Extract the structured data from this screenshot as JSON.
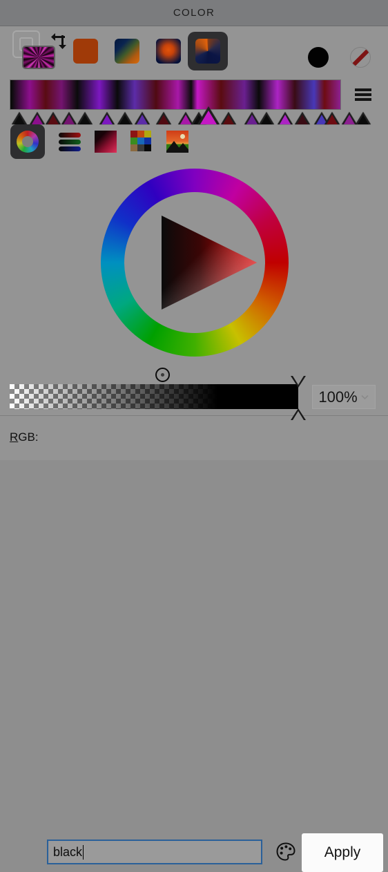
{
  "window": {
    "title": "COLOR"
  },
  "toolbar": {
    "fg_bg": {
      "foreground_name": "foreground-swatch",
      "background_name": "background-swatch",
      "swap_label": "swap-colors"
    },
    "gradient_types": [
      {
        "name": "solid",
        "label": "Solid color",
        "selected": false
      },
      {
        "name": "linear",
        "label": "Linear gradient",
        "selected": false
      },
      {
        "name": "radial",
        "label": "Radial gradient",
        "selected": false
      },
      {
        "name": "conical",
        "label": "Conical gradient",
        "selected": true
      }
    ],
    "black_swatch_label": "Black",
    "no_color_label": "No color"
  },
  "gradient_strip": {
    "menu_label": "Gradient menu",
    "stops": [
      {
        "position": 2,
        "color": "#0c0c0c",
        "selected": false
      },
      {
        "position": 28,
        "color": "#8c0f8c",
        "selected": false
      },
      {
        "position": 51,
        "color": "#5a0c12",
        "selected": false
      },
      {
        "position": 74,
        "color": "#741470",
        "selected": false
      },
      {
        "position": 97,
        "color": "#0b0b0b",
        "selected": false
      },
      {
        "position": 129,
        "color": "#7c18c0",
        "selected": false
      },
      {
        "position": 155,
        "color": "#0a0a0a",
        "selected": false
      },
      {
        "position": 180,
        "color": "#5c2ca8",
        "selected": false
      },
      {
        "position": 211,
        "color": "#500a12",
        "selected": false
      },
      {
        "position": 243,
        "color": "#a818a8",
        "selected": false
      },
      {
        "position": 262,
        "color": "#0c0c0c",
        "selected": false
      },
      {
        "position": 271,
        "color": "#c418c4",
        "selected": true
      },
      {
        "position": 305,
        "color": "#5a0c10",
        "selected": false
      },
      {
        "position": 339,
        "color": "#6a2090",
        "selected": false
      },
      {
        "position": 360,
        "color": "#0a0a0a",
        "selected": false
      },
      {
        "position": 387,
        "color": "#ac24c4",
        "selected": false
      },
      {
        "position": 412,
        "color": "#3a0c14",
        "selected": false
      },
      {
        "position": 440,
        "color": "#4838b8",
        "selected": false
      },
      {
        "position": 455,
        "color": "#6e0c12",
        "selected": false
      },
      {
        "position": 480,
        "color": "#8c2090",
        "selected": false
      },
      {
        "position": 500,
        "color": "#0a0a0a",
        "selected": false
      }
    ]
  },
  "mode_tabs": [
    {
      "name": "color-wheel",
      "label": "Color wheel",
      "selected": true
    },
    {
      "name": "sliders",
      "label": "Sliders",
      "selected": false
    },
    {
      "name": "gradient-square",
      "label": "Color square",
      "selected": false
    },
    {
      "name": "palette",
      "label": "Palettes",
      "selected": false
    },
    {
      "name": "image",
      "label": "Pick from image",
      "selected": false
    }
  ],
  "palette_grid_colors": [
    "#8c1414",
    "#c04a10",
    "#b0a810",
    "#3a8c20",
    "#1868b8",
    "#1030a0",
    "#8a6a40",
    "#3a3a3a",
    "#0a0a0a"
  ],
  "wheel": {
    "label": "Hue ring and saturation/value triangle",
    "cursor_label": "color-cursor"
  },
  "alpha": {
    "slider_label": "Opacity slider",
    "value": "100%",
    "chevron": "chevron-down-icon"
  },
  "footer": {
    "rgb_label_prefix": "R",
    "rgb_label_rest": "GB:",
    "input_value": "black",
    "input_placeholder": "",
    "palette_icon": "palette-icon",
    "apply_label": "Apply"
  },
  "colors": {
    "titlebar_bg": "#7b7c7e",
    "window_bg": "#949494",
    "accent_focus": "#2a6099",
    "apply_bg": "#fbfbfb"
  }
}
